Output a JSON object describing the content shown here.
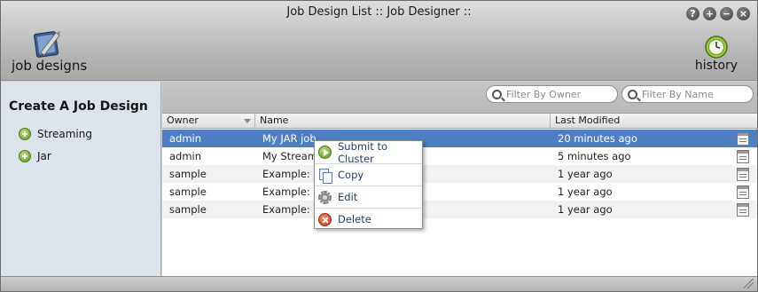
{
  "window": {
    "title": "Job Design List :: Job Designer ::",
    "buttons": [
      "?",
      "+",
      "−",
      "×"
    ]
  },
  "app": {
    "name": "job designs",
    "history_label": "history"
  },
  "sidebar": {
    "heading": "Create A Job Design",
    "items": [
      {
        "label": "Streaming",
        "icon": "add-icon"
      },
      {
        "label": "Jar",
        "icon": "add-icon"
      }
    ]
  },
  "filters": {
    "owner_placeholder": "Filter By Owner",
    "name_placeholder": "Filter By Name"
  },
  "table": {
    "columns": [
      "Owner",
      "Name",
      "Last Modified"
    ],
    "rows": [
      {
        "owner": "admin",
        "name": "My JAR job",
        "modified": "20 minutes ago",
        "selected": true
      },
      {
        "owner": "admin",
        "name": "My Stream",
        "modified": "5 minutes ago",
        "selected": false
      },
      {
        "owner": "sample",
        "name": "Example: S",
        "modified": "1 year ago",
        "selected": false
      },
      {
        "owner": "sample",
        "name": "Example: F",
        "modified": "1 year ago",
        "selected": false
      },
      {
        "owner": "sample",
        "name": "Example: S",
        "modified": "1 year ago",
        "selected": false
      }
    ]
  },
  "context_menu": {
    "items": [
      {
        "label": "Submit to Cluster",
        "icon": "play-icon"
      },
      {
        "label": "Copy",
        "icon": "copy-icon"
      },
      {
        "label": "Edit",
        "icon": "gear-icon"
      },
      {
        "label": "Delete",
        "icon": "delete-icon"
      }
    ]
  },
  "colors": {
    "selection": "#4e7fc2",
    "sidebar_bg": "#dde3ea",
    "menu_text": "#1f3f6f"
  }
}
